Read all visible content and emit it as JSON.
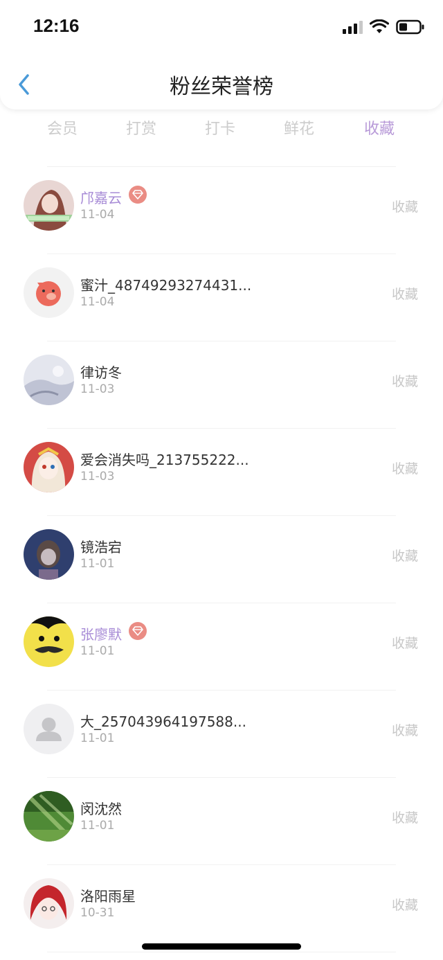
{
  "status_bar": {
    "time": "12:16"
  },
  "nav": {
    "title": "粉丝荣誉榜"
  },
  "tabs": [
    {
      "label": "会员"
    },
    {
      "label": "打赏"
    },
    {
      "label": "打卡"
    },
    {
      "label": "鲜花"
    },
    {
      "label": "收藏"
    }
  ],
  "active_tab": "收藏",
  "colors": {
    "accent": "#b89ad8",
    "vip_name": "#a78bd6",
    "badge": "#ea8c84"
  },
  "list": [
    {
      "name": "邝嘉云",
      "date": "11-04",
      "action": "收藏",
      "vip": true,
      "avatar": "anime-girl-avatar"
    },
    {
      "name": "蜜汁_48749293274431...",
      "date": "11-04",
      "action": "收藏",
      "vip": false,
      "avatar": "red-pig-avatar"
    },
    {
      "name": "律访冬",
      "date": "11-03",
      "action": "收藏",
      "vip": false,
      "avatar": "snow-scene-avatar"
    },
    {
      "name": "爱会消失吗_213755222...",
      "date": "11-03",
      "action": "收藏",
      "vip": false,
      "avatar": "anime-character-avatar"
    },
    {
      "name": "镜浩宕",
      "date": "11-01",
      "action": "收藏",
      "vip": false,
      "avatar": "dark-portrait-avatar"
    },
    {
      "name": "张廖默",
      "date": "11-01",
      "action": "收藏",
      "vip": true,
      "avatar": "yellow-meme-avatar"
    },
    {
      "name": "大_257043964197588...",
      "date": "11-01",
      "action": "收藏",
      "vip": false,
      "avatar": "default-user-avatar"
    },
    {
      "name": "闵沈然",
      "date": "11-01",
      "action": "收藏",
      "vip": false,
      "avatar": "green-forest-avatar"
    },
    {
      "name": "洛阳雨星",
      "date": "10-31",
      "action": "收藏",
      "vip": false,
      "avatar": "red-hair-girl-avatar"
    }
  ]
}
